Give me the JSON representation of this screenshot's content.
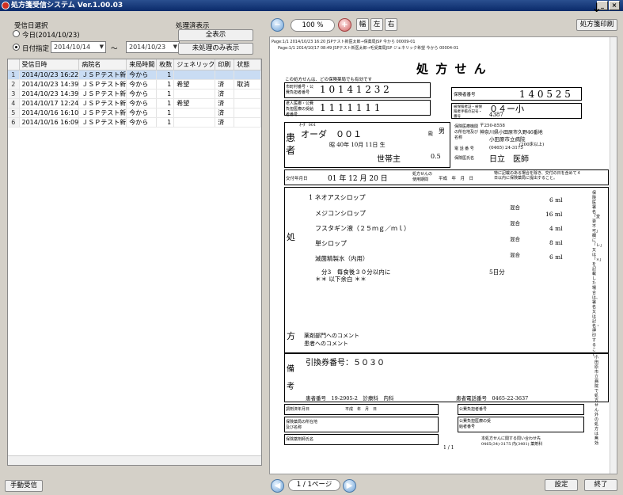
{
  "window": {
    "title": "処方箋受信システム Ver.1.00.03",
    "controls": [
      "_",
      "×"
    ]
  },
  "left": {
    "date_section_label": "受信日選択",
    "radio_today": "今日(2014/10/23)",
    "radio_range": "日付指定",
    "date_from": "2014/10/14",
    "tilde": "～",
    "date_to": "2014/10/23",
    "proc_label": "処理済表示",
    "btn_all": "全表示",
    "btn_unproc": "未処理のみ表示",
    "columns": [
      "受信日時",
      "病院名",
      "来局時間",
      "枚数",
      "ジェネリック",
      "印刷",
      "状態"
    ],
    "rows": [
      [
        "1",
        "2014/10/23 16:22",
        "ＪＳＰテスト新",
        "今から",
        "1",
        "",
        "",
        ""
      ],
      [
        "2",
        "2014/10/23 14:39",
        "ＪＳＰテスト新",
        "今から",
        "1",
        "希望",
        "済",
        "取消"
      ],
      [
        "3",
        "2014/10/23 14:39",
        "ＪＳＰテスト新",
        "今から",
        "1",
        "",
        "済",
        ""
      ],
      [
        "4",
        "2014/10/17 12:24",
        "ＪＳＰテスト新",
        "今から",
        "1",
        "希望",
        "済",
        ""
      ],
      [
        "5",
        "2014/10/16 16:10",
        "ＪＳＰテスト新",
        "今から",
        "1",
        "",
        "済",
        ""
      ],
      [
        "6",
        "2014/10/16 16:09",
        "ＪＳＰテスト新",
        "今から",
        "1",
        "",
        "済",
        ""
      ]
    ],
    "manual_btn": "手動受信"
  },
  "right": {
    "zoom": "100 %",
    "btn_width": "幅",
    "btn_left": "左",
    "btn_right": "右",
    "print_btn": "処方箋印刷",
    "header1": "Page:1/1 2014/10/23 16:20 JSPテスト新医太郎→保薬局JSP 今から 00009-01",
    "header2": "Page:1/1 2014/10/17 08:49 JSPテスト新医太郎→毛受薬局JSP ジェネリック希望 今から 00004-01",
    "pager": "1 / 1ページ",
    "settings_btn": "設定",
    "exit_btn": "終了"
  },
  "rx": {
    "title": "処 方 せ ん",
    "subtitle": "この処方せんは、どの保険薬局でも有効です",
    "l_pubno": "市町村番号・公費負担者番号",
    "pubno": "1 0 1 4 1 2 3 2",
    "l_recip": "老人医療・公費負担医療の受給者番号",
    "recip": "1 1 1 1 1 1 1",
    "l_insno": "保険者番号",
    "insno": "1 4 0 5 2 5",
    "l_card": "被保険者証・被保険者手帳の記号・番号",
    "card": "０４ー小",
    "card2": "4387",
    "kana": "ｵｰﾀﾞ 001",
    "name": "オーダ　００１",
    "sama": "殿",
    "sex": "男",
    "dob": "昭 40年 10月 11日 生",
    "l_patient": "患 者",
    "kubun": "世帯主",
    "ratio": "0.5",
    "zip": "〒250-8558",
    "addr1": "神奈川県小田原市久野46番地",
    "hosp": "小田原市立病院",
    "beds": "(200床以上)",
    "tel": "(0465) 24-3175",
    "doctor": "日立　医師",
    "l_addr": "保険医療機関の所在地及び名称",
    "l_tel": "電 話 番 号",
    "l_doc": "保険医氏名",
    "l_issued": "交付年月日",
    "issued": "01 年 12 月 20 日",
    "l_valid": "処方せんの使用期間",
    "valid": "平成　年　月　日",
    "valid_note": "特に記載のある場合を除き、交付の日を含めて４日以内に保険薬局に提出すること。",
    "l_rx": "処",
    "l_kata": "方",
    "items": [
      "1 ネオアスシロップ",
      "メジコンシロップ",
      "フスタギン液（２５ｍｇ／ｍｌ）",
      "単シロップ",
      "滅菌精製水（内用）",
      "分3　毎食後３０分以内に",
      "＊＊ 以下余白 ＊＊"
    ],
    "mix": [
      "混合",
      "混合",
      "混合",
      "混合"
    ],
    "amounts": [
      "6 ml",
      "16 ml",
      "4 ml",
      "8 ml",
      "6 ml"
    ],
    "days": "5日分",
    "side_note": "保険医署名「変更不可」欄に「レ」又は「×」を記載した場合は、署名又は記名・押印すること。",
    "comment1": "薬剤部門へのコメント",
    "comment2": "患者へのコメント",
    "l_biko": "備考",
    "coupon": "引換券番号：５０３０",
    "patno": "患者番号　19-2905-2　診療科　内科",
    "pattel": "患者電話番号　0465-22-3637",
    "l_dispdate": "調剤済年月日",
    "dispdate": "平成　年　月　日",
    "l_pharm": "保険薬局の所在地及び名称",
    "l_pharmacist": "保険薬剤師氏名",
    "l_pub2": "公費負担者番号",
    "l_recip2": "公費負担医療の受給者番号",
    "inquiry": "本処方せんに関する問い合わせ先",
    "inquiry_tel": "0465(34)-3175 内(3401) 薬剤科",
    "pgnum": "1 / 1",
    "right_note": "小田原市立病院で処方せん外の処方は無効"
  }
}
